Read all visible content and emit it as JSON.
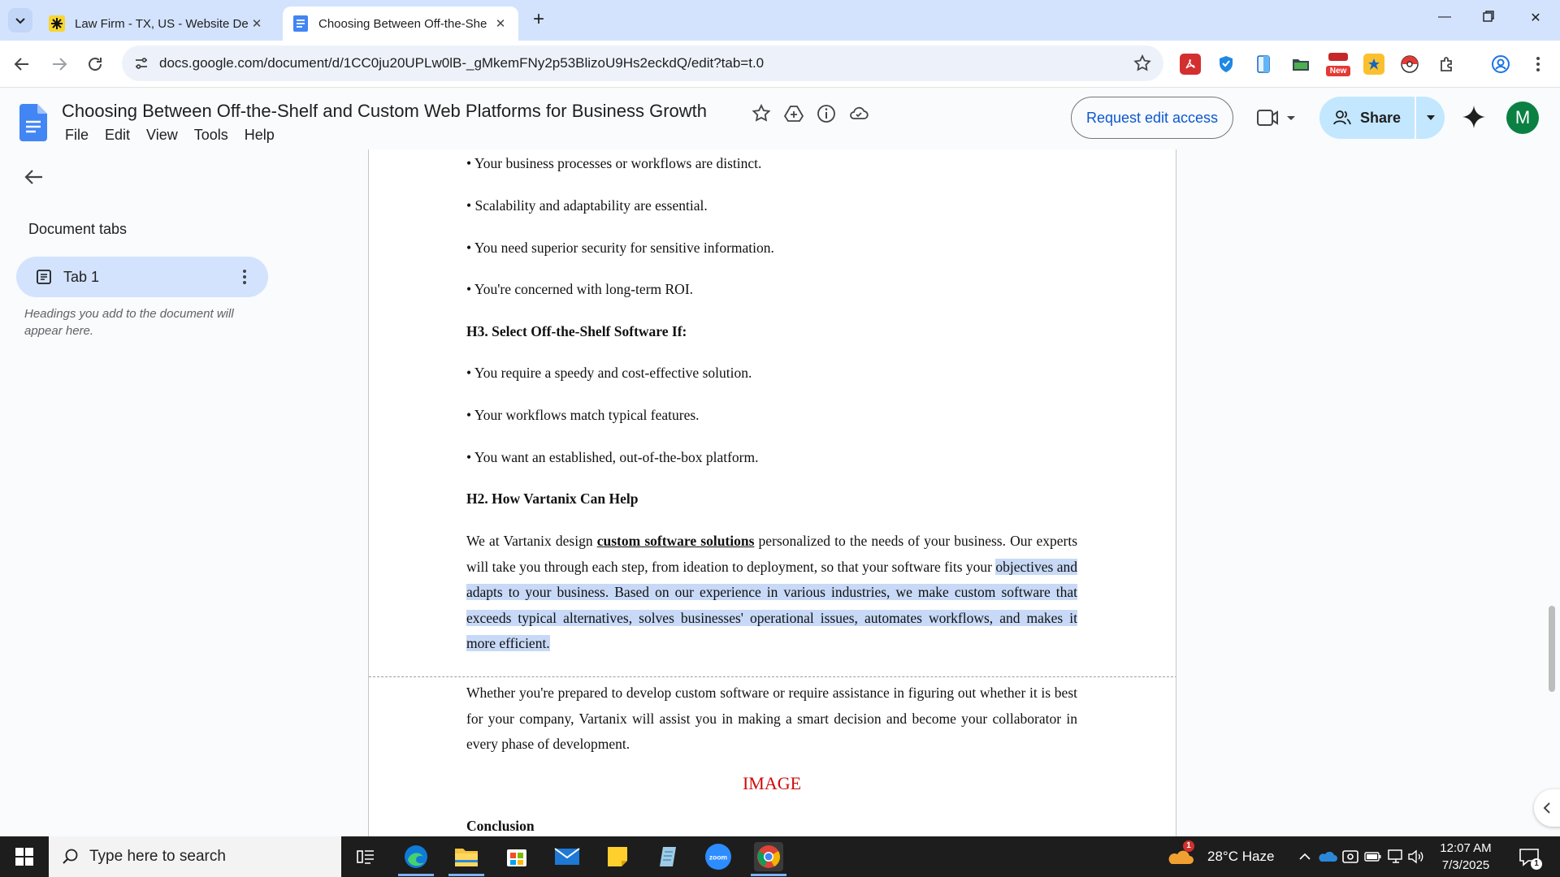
{
  "browser": {
    "tabs": [
      {
        "title": "Law Firm - TX, US - Website De",
        "active": false
      },
      {
        "title": "Choosing Between Off-the-She",
        "active": true
      }
    ],
    "url": "docs.google.com/document/d/1CC0ju20UPLw0lB-_gMkemFNy2p53BlizoU9Hs2eckdQ/edit?tab=t.0",
    "extensions": [
      "pdf-icon",
      "shield-extension-icon",
      "notebook-extension-icon",
      "folder-extension-icon",
      "new-badge-extension-icon",
      "star-extension-icon",
      "pokeball-extension-icon",
      "puzzle-icon",
      "profile-icon",
      "kebab-menu-icon"
    ],
    "new_badge": "New"
  },
  "docs": {
    "title": "Choosing Between Off-the-Shelf and Custom Web Platforms for Business Growth",
    "menu": [
      "File",
      "Edit",
      "View",
      "Tools",
      "Help"
    ],
    "request_edit": "Request edit access",
    "share": "Share",
    "avatar_initial": "M"
  },
  "sidebar": {
    "heading": "Document tabs",
    "tab_label": "Tab 1",
    "hint": "Headings you add to the document will appear here."
  },
  "document": {
    "b1": "• Your business processes or workflows are distinct.",
    "b2": "• Scalability and adaptability are essential.",
    "b3": "• You need superior security for sensitive information.",
    "b4": "• You're concerned with long-term ROI.",
    "h3": "H3. Select Off-the-Shelf Software If:",
    "b5": "• You require a speedy and cost-effective solution.",
    "b6": "• Your workflows match typical features.",
    "b7": "• You want an established, out-of-the-box platform.",
    "h2": "H2. How Vartanix Can Help",
    "p1_a": "We at Vartanix design ",
    "p1_link": "custom software solutions",
    "p1_b": " personalized to the needs of your business. Our experts will take you through each step, from ideation to deployment, so that your software fits your ",
    "p1_sel": "objectives and adapts to your business. Based on our experience in various industries, we make custom software that exceeds typical alternatives, solves businesses' operational issues, automates workflows, and makes it more efficient.",
    "p2": "Whether you're prepared to develop custom software or require assistance in figuring out whether it is best for your company, Vartanix will assist you in making a smart decision and become your collaborator in every phase of development.",
    "image_placeholder": "IMAGE",
    "conclusion": "Conclusion"
  },
  "taskbar": {
    "search_placeholder": "Type here to search",
    "weather": "28°C  Haze",
    "weather_badge": "1",
    "time": "12:07 AM",
    "date": "7/3/2025",
    "notification_count": "1"
  },
  "colors": {
    "accent": "#0b57d0",
    "share_bg": "#c2e7ff",
    "selection": "#c7d9f6",
    "image_placeholder": "#d10a0a"
  }
}
